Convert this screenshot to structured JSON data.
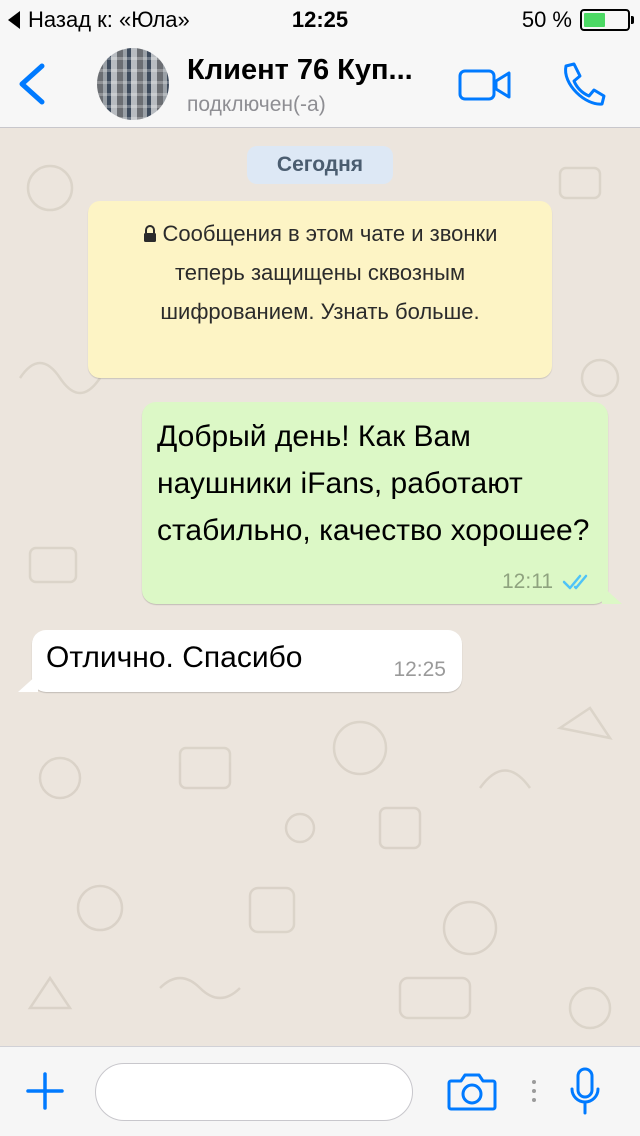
{
  "status_bar": {
    "back_text": "Назад к: «Юла»",
    "time": "12:25",
    "battery_percent": "50 %",
    "battery_level": 0.5
  },
  "header": {
    "contact_name": "Клиент 76 Куп...",
    "contact_status": "подключен(-а)"
  },
  "chat": {
    "date_chip": "Сегодня",
    "encryption_notice": "Сообщения в этом чате и звонки теперь защищены сквозным шифрованием. Узнать больше.",
    "messages": [
      {
        "direction": "outgoing",
        "text": "Добрый день! Как Вам наушники iFans, работают стабильно, качество хорошее?",
        "time": "12:11",
        "status": "read"
      },
      {
        "direction": "incoming",
        "text": "Отлично. Спасибо",
        "time": "12:25"
      }
    ]
  },
  "input_bar": {
    "placeholder": ""
  },
  "colors": {
    "accent": "#007aff",
    "outgoing_bubble": "#dcf8c6",
    "incoming_bubble": "#ffffff",
    "notice_bg": "#fdf4c5",
    "read_ticks": "#4fc3f7"
  },
  "icons": [
    "back-chevron-icon",
    "video-call-icon",
    "phone-icon",
    "lock-icon",
    "double-check-icon",
    "plus-icon",
    "camera-icon",
    "microphone-icon"
  ]
}
